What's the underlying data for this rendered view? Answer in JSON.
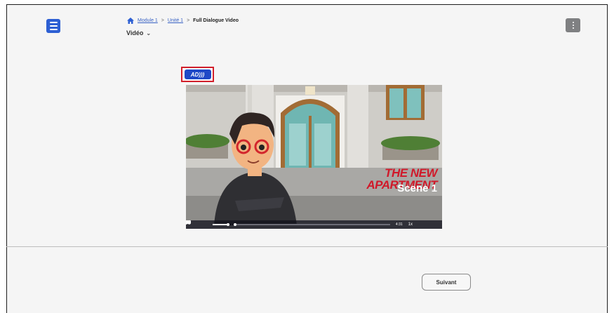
{
  "header": {
    "breadcrumb": {
      "items": [
        "Module 1",
        "Unité 1"
      ],
      "separator": ">",
      "current": "Full Dialogue Video"
    },
    "section_title": "Vidéo",
    "menu_icon": "hamburger-menu-icon",
    "more_icon": "more-vertical-icon"
  },
  "audio_description_button": {
    "label": "AD)))"
  },
  "video": {
    "overlay_title": "THE NEW APARTMENT",
    "overlay_subtitle": "Scene 1",
    "controls": {
      "time": "4:31",
      "speed": "1x"
    }
  },
  "footer": {
    "next_label": "Suivant"
  },
  "colors": {
    "accent": "#2d5fd3",
    "ad_button": "#1f49c7",
    "highlight_border": "#d21f2b",
    "title_red": "#d0192a"
  }
}
